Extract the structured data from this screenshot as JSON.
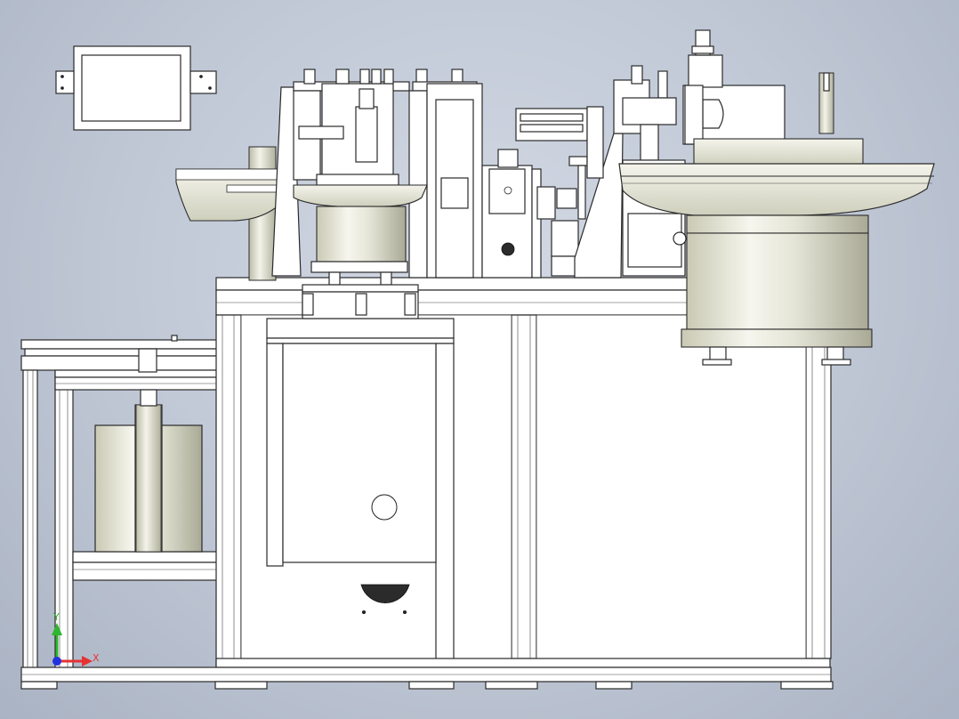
{
  "viewport": {
    "background_top": "#d3d9e4",
    "background_bottom": "#aab3c3"
  },
  "triad": {
    "x_label": "X",
    "y_label": "Y",
    "x_color": "#e53333",
    "y_color": "#2fb52f",
    "origin_color": "#2233dd"
  },
  "parts": {
    "base_frame": "machine-base-frame",
    "left_bowl_feeder": "left-vibratory-bowl-feeder",
    "right_bowl_feeder": "right-vibratory-bowl-feeder",
    "center_rotary_table": "rotary-indexing-table",
    "hmi_panel": "touch-screen-panel",
    "conveyor_frame": "left-conveyor-frame",
    "lower_cylinder": "lower-storage-cylinder"
  }
}
